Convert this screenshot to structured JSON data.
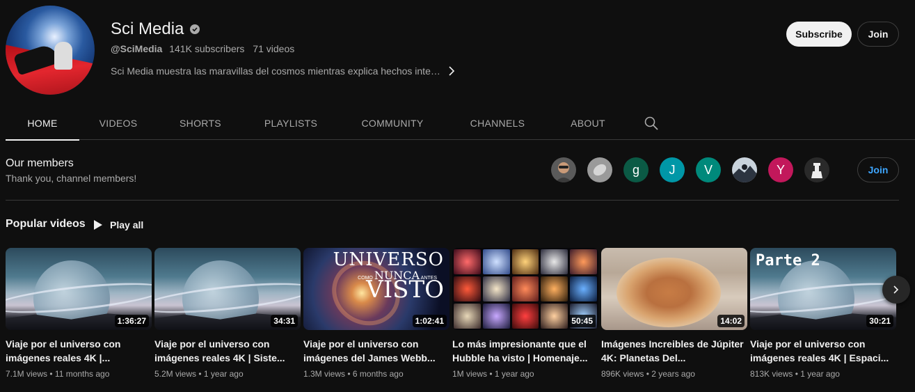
{
  "channel": {
    "name": "Sci Media",
    "handle": "@SciMedia",
    "subscribers": "141K subscribers",
    "video_count": "71 videos",
    "description": "Sci Media muestra las maravillas del cosmos mientras explica hechos inte…"
  },
  "buttons": {
    "subscribe": "Subscribe",
    "join": "Join"
  },
  "tabs": [
    {
      "label": "HOME",
      "active": true
    },
    {
      "label": "VIDEOS"
    },
    {
      "label": "SHORTS"
    },
    {
      "label": "PLAYLISTS"
    },
    {
      "label": "COMMUNITY"
    },
    {
      "label": "CHANNELS"
    },
    {
      "label": "ABOUT"
    }
  ],
  "members": {
    "title": "Our members",
    "subtitle": "Thank you, channel members!",
    "avatars": [
      {
        "letter": "",
        "color": "#5a5a5a"
      },
      {
        "letter": "",
        "color": "#9a9a9a"
      },
      {
        "letter": "g",
        "color": "#0b5a45"
      },
      {
        "letter": "J",
        "color": "#0097a7"
      },
      {
        "letter": "V",
        "color": "#00897b"
      },
      {
        "letter": "",
        "color": "#c9d3dc"
      },
      {
        "letter": "Y",
        "color": "#c2185b"
      },
      {
        "letter": "",
        "color": "#2a2a2a"
      }
    ],
    "join_label": "Join"
  },
  "popular": {
    "title": "Popular videos",
    "play_all": "Play all",
    "videos": [
      {
        "title": "Viaje por el universo con imágenes reales 4K |...",
        "duration": "1:36:27",
        "views": "7.1M views",
        "age": "11 months ago"
      },
      {
        "title": "Viaje por el universo con imágenes reales 4K | Siste...",
        "duration": "34:31",
        "views": "5.2M views",
        "age": "1 year ago"
      },
      {
        "title": "Viaje por el universo con imágenes del James Webb...",
        "duration": "1:02:41",
        "views": "1.3M views",
        "age": "6 months ago"
      },
      {
        "title": "Lo más impresionante que el Hubble ha visto | Homenaje...",
        "duration": "50:45",
        "views": "1M views",
        "age": "1 year ago"
      },
      {
        "title": "Imágenes Increibles de Júpiter 4K: Planetas Del...",
        "duration": "14:02",
        "views": "896K views",
        "age": "2 years ago"
      },
      {
        "title": "Viaje por el universo con imágenes reales 4K | Espaci...",
        "duration": "30:21",
        "views": "813K views",
        "age": "1 year ago"
      }
    ]
  },
  "thumb_text": {
    "universo": "UNIVERSO",
    "como": "COMO",
    "nunca": "NUNCA",
    "antes": "ANTES",
    "visto": "VISTO",
    "parte2": "Parte 2"
  },
  "colors": {
    "background": "#0f0f0f",
    "accent_blue": "#3ea6ff"
  }
}
